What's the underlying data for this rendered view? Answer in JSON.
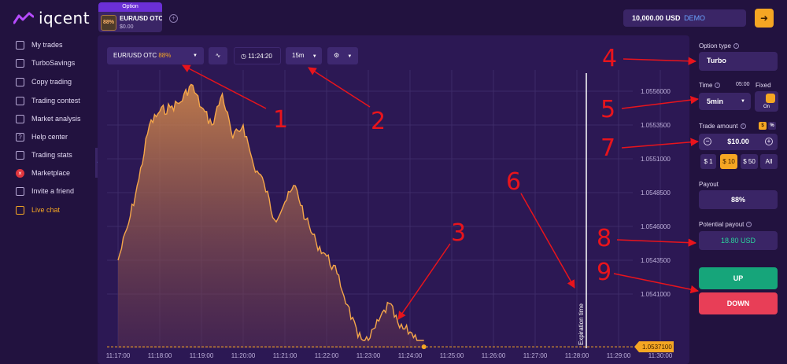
{
  "app": {
    "logo_text": "iqcent"
  },
  "asset_tab": {
    "header": "Option",
    "badge": "88%",
    "name": "EUR/USD OTC",
    "price": "$0.00"
  },
  "account": {
    "balance": "10,000.00 USD",
    "mode": "DEMO"
  },
  "sidebar": {
    "items": [
      {
        "label": "My trades",
        "icon": "clipboard-icon"
      },
      {
        "label": "TurboSavings",
        "icon": "piggy-icon"
      },
      {
        "label": "Copy trading",
        "icon": "copy-icon"
      },
      {
        "label": "Trading contest",
        "icon": "trophy-icon"
      },
      {
        "label": "Market analysis",
        "icon": "chart-icon"
      },
      {
        "label": "Help center",
        "icon": "help-icon"
      },
      {
        "label": "Trading stats",
        "icon": "stats-icon"
      },
      {
        "label": "Marketplace",
        "icon": "marketplace-icon"
      },
      {
        "label": "Invite a friend",
        "icon": "invite-icon"
      },
      {
        "label": "Live chat",
        "icon": "chat-icon"
      }
    ]
  },
  "toolbar": {
    "asset_name": "EUR/USD OTC",
    "asset_payout": "88%",
    "clock": "11:24:20",
    "timeframe": "15m"
  },
  "chart": {
    "current_price": "1.0537100",
    "expiration_label": "Expiration time",
    "price_ticks": [
      "1.0556000",
      "1.0553500",
      "1.0551000",
      "1.0548500",
      "1.0546000",
      "1.0543500",
      "1.0541000"
    ],
    "time_ticks": [
      "11:17:00",
      "11:18:00",
      "11:19:00",
      "11:20:00",
      "11:21:00",
      "11:22:00",
      "11:23:00",
      "11:24:00",
      "11:25:00",
      "11:26:00",
      "11:27:00",
      "11:28:00",
      "11:29:00",
      "11:30:00"
    ],
    "series_color": "#f5a64a"
  },
  "right_panel": {
    "option_type_label": "Option type",
    "option_type_value": "Turbo",
    "time_label": "Time",
    "time_value_small": "05:00",
    "fixed_label": "Fixed",
    "time_value": "5min",
    "toggle_label": "On",
    "trade_amount_label": "Trade amount",
    "unit_dollar": "$",
    "unit_percent": "%",
    "amount_value": "$10.00",
    "amount_presets": [
      "$ 1",
      "$ 10",
      "$ 50",
      "All"
    ],
    "payout_label": "Payout",
    "payout_value": "88%",
    "potential_payout_label": "Potential payout",
    "potential_payout_value": "18.80 USD",
    "up_label": "UP",
    "down_label": "DOWN"
  },
  "annotations": [
    "1",
    "2",
    "3",
    "4",
    "5",
    "6",
    "7",
    "8",
    "9"
  ],
  "chart_data": {
    "type": "area",
    "x": [
      "11:17:00",
      "11:17:15",
      "11:17:30",
      "11:17:45",
      "11:18:00",
      "11:18:15",
      "11:18:30",
      "11:18:45",
      "11:19:00",
      "11:19:15",
      "11:19:30",
      "11:19:45",
      "11:20:00",
      "11:20:15",
      "11:20:30",
      "11:20:45",
      "11:21:00",
      "11:21:15",
      "11:21:30",
      "11:21:45",
      "11:22:00",
      "11:22:15",
      "11:22:30",
      "11:22:45",
      "11:23:00",
      "11:23:15",
      "11:23:30",
      "11:23:45",
      "11:24:00",
      "11:24:15",
      "11:24:20"
    ],
    "values": [
      1.05435,
      1.05462,
      1.05495,
      1.05535,
      1.05545,
      1.05548,
      1.05552,
      1.05565,
      1.05548,
      1.05535,
      1.05558,
      1.05525,
      1.05535,
      1.05505,
      1.05492,
      1.05465,
      1.05478,
      1.0549,
      1.05465,
      1.05448,
      1.05438,
      1.05425,
      1.05402,
      1.05378,
      1.05375,
      1.0539,
      1.05403,
      1.05385,
      1.05382,
      1.05375,
      1.05371
    ],
    "yticks": [
      1.0556,
      1.05535,
      1.0551,
      1.05485,
      1.0546,
      1.05435,
      1.0541
    ],
    "current_price": 1.05371
  }
}
